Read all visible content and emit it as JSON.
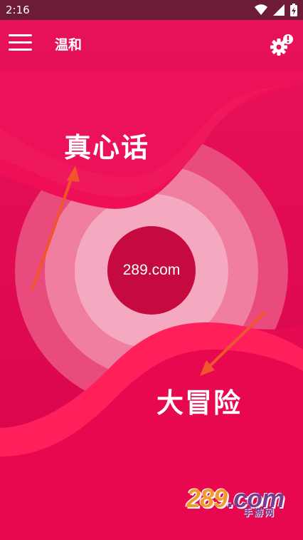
{
  "status_bar": {
    "time": "2:16",
    "icons": [
      "wifi-icon",
      "signal-icon",
      "battery-icon"
    ]
  },
  "header": {
    "title": "温和",
    "menu_icon": "hamburger-menu-icon",
    "settings_icon": "gear-icon"
  },
  "game": {
    "truth_label": "真心话",
    "dare_label": "大冒险",
    "center_label": "289.com"
  },
  "watermark": {
    "brand_number": "289",
    "brand_suffix": ".com",
    "brand_sub": "手游网"
  },
  "colors": {
    "background": "#e0064f",
    "status_bar": "#6e1a39",
    "wave": "#ff1f5a",
    "ring_outer": "#e94b7c",
    "ring_middle": "#f07ea1",
    "ring_inner": "#f4a9c1",
    "center": "#c40a3e",
    "arrow": "#f0552d"
  }
}
